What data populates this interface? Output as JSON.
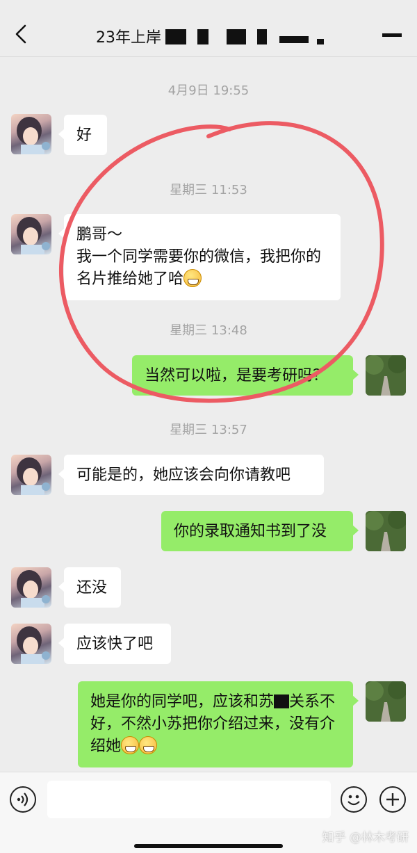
{
  "header": {
    "title": "23年上岸",
    "back_icon": "chevron-left-icon",
    "more_icon": "more-icon"
  },
  "messages": {
    "ts1": "4月9日 19:55",
    "m1": "好",
    "ts2": "星期三 11:53",
    "m2_line1": "鹏哥～",
    "m2_line2": "我一个同学需要你的微信，我把你的名片推给她了哈",
    "ts3": "星期三 13:48",
    "m3": "当然可以啦，是要考研吗？",
    "ts4": "星期三 13:57",
    "m4": "可能是的，她应该会向你请教吧",
    "m5": "你的录取通知书到了没",
    "m6": "还没",
    "m7": "应该快了吧",
    "m8_a": "她是你的同学吧，应该和",
    "m8_b": "苏",
    "m8_c": "关系不好，不然小苏把你介绍过来，没有介绍她"
  },
  "bottom": {
    "voice_icon": "voice-icon",
    "emoji_icon": "emoji-icon",
    "plus_icon": "plus-icon"
  },
  "watermark": "知乎 @林木考研",
  "colors": {
    "bubble_self": "#95ec69",
    "bubble_other": "#ffffff",
    "annotation_circle": "#ec5b63"
  }
}
